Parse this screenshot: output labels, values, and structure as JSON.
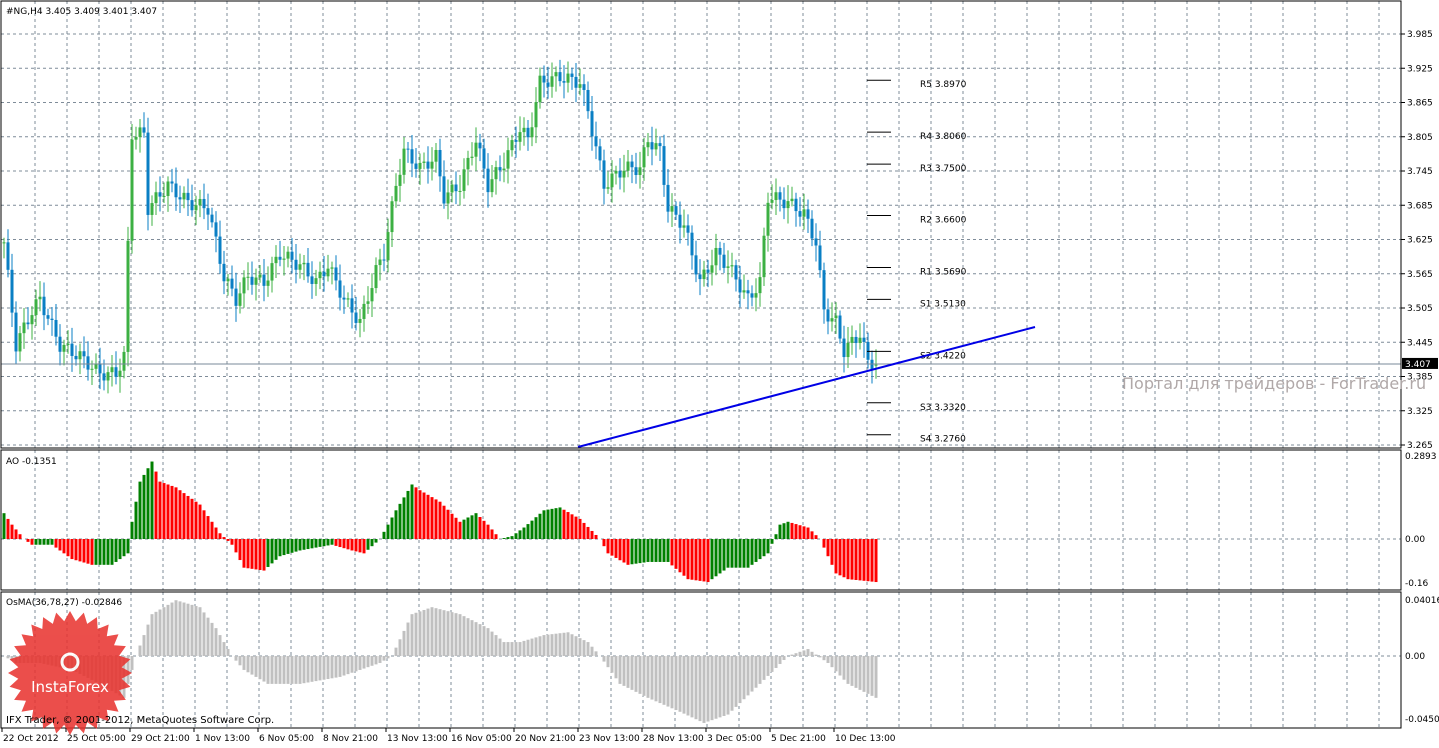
{
  "header": {
    "title": "#NG,H4  3.405 3.409 3.401 3.407"
  },
  "ao_label": "AO -0.1351",
  "osma_label": "OsMA(36,78,27) -0.02846",
  "copyright": "IFX Trader, © 2001-2012, MetaQuotes Software Corp.",
  "watermark": "Портал для трейдеров - ForTrader.ru",
  "logo_text": "InstaForex",
  "colors": {
    "up": "#3cb043",
    "down": "#0a7fc4",
    "ao_up": "#008000",
    "ao_down": "#ff0000",
    "osma": "#c0c0c0",
    "trend": "#0000e6",
    "grid": "#7f8c99"
  },
  "chart_data": [
    {
      "type": "candlestick",
      "title": "#NG,H4",
      "ohlc_last": {
        "open": 3.405,
        "high": 3.409,
        "low": 3.401,
        "close": 3.407
      },
      "current_price": 3.407,
      "current_price_label": "3.407",
      "ylim": [
        3.265,
        3.985
      ],
      "yticks": [
        "3.985",
        "3.925",
        "3.865",
        "3.805",
        "3.745",
        "3.685",
        "3.625",
        "3.565",
        "3.505",
        "3.445",
        "3.385",
        "3.325",
        "3.265"
      ],
      "xticks": [
        "22 Oct 2012",
        "25 Oct 05:00",
        "29 Oct 21:00",
        "1 Nov 13:00",
        "6 Nov 05:00",
        "8 Nov 21:00",
        "13 Nov 13:00",
        "16 Nov 05:00",
        "20 Nov 21:00",
        "23 Nov 13:00",
        "28 Nov 13:00",
        "3 Dec 05:00",
        "5 Dec 21:00",
        "10 Dec 13:00"
      ],
      "bars": 219,
      "close_keypoints": [
        [
          0,
          3.62
        ],
        [
          3,
          3.44
        ],
        [
          7,
          3.5
        ],
        [
          9,
          3.52
        ],
        [
          14,
          3.44
        ],
        [
          19,
          3.42
        ],
        [
          24,
          3.39
        ],
        [
          28,
          3.39
        ],
        [
          30,
          3.42
        ],
        [
          32,
          3.81
        ],
        [
          35,
          3.81
        ],
        [
          36,
          3.68
        ],
        [
          41,
          3.72
        ],
        [
          46,
          3.69
        ],
        [
          51,
          3.68
        ],
        [
          55,
          3.56
        ],
        [
          58,
          3.52
        ],
        [
          61,
          3.56
        ],
        [
          65,
          3.55
        ],
        [
          69,
          3.6
        ],
        [
          74,
          3.58
        ],
        [
          78,
          3.55
        ],
        [
          81,
          3.58
        ],
        [
          85,
          3.52
        ],
        [
          89,
          3.48
        ],
        [
          93,
          3.57
        ],
        [
          95,
          3.6
        ],
        [
          98,
          3.72
        ],
        [
          100,
          3.78
        ],
        [
          104,
          3.75
        ],
        [
          108,
          3.77
        ],
        [
          110,
          3.7
        ],
        [
          114,
          3.72
        ],
        [
          118,
          3.8
        ],
        [
          121,
          3.72
        ],
        [
          125,
          3.76
        ],
        [
          129,
          3.82
        ],
        [
          131,
          3.8
        ],
        [
          134,
          3.9
        ],
        [
          139,
          3.91
        ],
        [
          144,
          3.9
        ],
        [
          146,
          3.85
        ],
        [
          150,
          3.72
        ],
        [
          155,
          3.75
        ],
        [
          159,
          3.75
        ],
        [
          161,
          3.8
        ],
        [
          164,
          3.78
        ],
        [
          166,
          3.68
        ],
        [
          170,
          3.65
        ],
        [
          174,
          3.55
        ],
        [
          178,
          3.6
        ],
        [
          181,
          3.58
        ],
        [
          186,
          3.52
        ],
        [
          189,
          3.55
        ],
        [
          191,
          3.7
        ],
        [
          196,
          3.69
        ],
        [
          200,
          3.67
        ],
        [
          203,
          3.62
        ],
        [
          205,
          3.5
        ],
        [
          208,
          3.48
        ],
        [
          210,
          3.43
        ],
        [
          214,
          3.46
        ],
        [
          216,
          3.41
        ],
        [
          218,
          3.407
        ]
      ],
      "pivots": [
        {
          "name": "R5",
          "value": 3.897,
          "label": "R5 3.8970"
        },
        {
          "name": "R4",
          "value": 3.806,
          "label": "R4 3.8060"
        },
        {
          "name": "R3",
          "value": 3.75,
          "label": "R3 3.7500"
        },
        {
          "name": "R2",
          "value": 3.66,
          "label": "R2 3.6600"
        },
        {
          "name": "R1",
          "value": 3.569,
          "label": "R1 3.5690"
        },
        {
          "name": "S1",
          "value": 3.513,
          "label": "S1 3.5130"
        },
        {
          "name": "S2",
          "value": 3.422,
          "label": "S2 3.4220"
        },
        {
          "name": "S3",
          "value": 3.332,
          "label": "S3 3.3320"
        },
        {
          "name": "S4",
          "value": 3.276,
          "label": "S4 3.2760"
        }
      ],
      "trendline": [
        [
          143.5,
          3.2615
        ],
        [
          257.75,
          3.4717
        ]
      ]
    },
    {
      "type": "bar",
      "title": "AO",
      "ylim": [
        -0.16,
        0.2893
      ],
      "yticks": [
        "0.2893",
        "0.00",
        "-0.16"
      ],
      "keypoints": [
        [
          0,
          0.09
        ],
        [
          2,
          0.05
        ],
        [
          5,
          0.0
        ],
        [
          7,
          -0.02
        ],
        [
          12,
          -0.02
        ],
        [
          17,
          -0.07
        ],
        [
          22,
          -0.09
        ],
        [
          27,
          -0.09
        ],
        [
          31,
          -0.05
        ],
        [
          32,
          0.06
        ],
        [
          34,
          0.2
        ],
        [
          37,
          0.27
        ],
        [
          39,
          0.2
        ],
        [
          43,
          0.18
        ],
        [
          49,
          0.12
        ],
        [
          54,
          0.02
        ],
        [
          57,
          -0.02
        ],
        [
          60,
          -0.1
        ],
        [
          65,
          -0.11
        ],
        [
          69,
          -0.06
        ],
        [
          74,
          -0.04
        ],
        [
          82,
          -0.02
        ],
        [
          87,
          -0.04
        ],
        [
          90,
          -0.05
        ],
        [
          94,
          0.0
        ],
        [
          98,
          0.1
        ],
        [
          102,
          0.19
        ],
        [
          104,
          0.17
        ],
        [
          109,
          0.13
        ],
        [
          114,
          0.06
        ],
        [
          118,
          0.09
        ],
        [
          121,
          0.05
        ],
        [
          124,
          0.0
        ],
        [
          127,
          0.01
        ],
        [
          130,
          0.04
        ],
        [
          135,
          0.1
        ],
        [
          139,
          0.11
        ],
        [
          144,
          0.07
        ],
        [
          149,
          0.0
        ],
        [
          151,
          -0.05
        ],
        [
          156,
          -0.09
        ],
        [
          161,
          -0.08
        ],
        [
          166,
          -0.08
        ],
        [
          171,
          -0.14
        ],
        [
          176,
          -0.15
        ],
        [
          181,
          -0.1
        ],
        [
          186,
          -0.1
        ],
        [
          191,
          -0.05
        ],
        [
          194,
          0.05
        ],
        [
          196,
          0.06
        ],
        [
          201,
          0.04
        ],
        [
          204,
          0.0
        ],
        [
          208,
          -0.12
        ],
        [
          211,
          -0.14
        ],
        [
          218,
          -0.15
        ]
      ]
    },
    {
      "type": "bar",
      "title": "OsMA(36,78,27)",
      "ylim": [
        -0.04505,
        0.04016
      ],
      "yticks": [
        "0.04016",
        "0.00",
        "-0.04505"
      ],
      "keypoints": [
        [
          0,
          0
        ],
        [
          3,
          -0.005
        ],
        [
          9,
          -0.005
        ],
        [
          17,
          -0.01
        ],
        [
          24,
          -0.02
        ],
        [
          30,
          -0.03
        ],
        [
          33,
          0.0
        ],
        [
          37,
          0.03
        ],
        [
          43,
          0.04
        ],
        [
          49,
          0.035
        ],
        [
          53,
          0.02
        ],
        [
          57,
          0.0
        ],
        [
          60,
          -0.01
        ],
        [
          66,
          -0.02
        ],
        [
          74,
          -0.02
        ],
        [
          84,
          -0.015
        ],
        [
          94,
          -0.005
        ],
        [
          97,
          0.0
        ],
        [
          102,
          0.03
        ],
        [
          107,
          0.035
        ],
        [
          114,
          0.03
        ],
        [
          121,
          0.02
        ],
        [
          125,
          0.01
        ],
        [
          129,
          0.01
        ],
        [
          135,
          0.015
        ],
        [
          141,
          0.017
        ],
        [
          146,
          0.01
        ],
        [
          149,
          0.0
        ],
        [
          154,
          -0.02
        ],
        [
          161,
          -0.03
        ],
        [
          169,
          -0.04
        ],
        [
          175,
          -0.048
        ],
        [
          181,
          -0.042
        ],
        [
          189,
          -0.02
        ],
        [
          196,
          0.0
        ],
        [
          201,
          0.005
        ],
        [
          206,
          -0.005
        ],
        [
          211,
          -0.02
        ],
        [
          218,
          -0.03
        ]
      ]
    }
  ]
}
